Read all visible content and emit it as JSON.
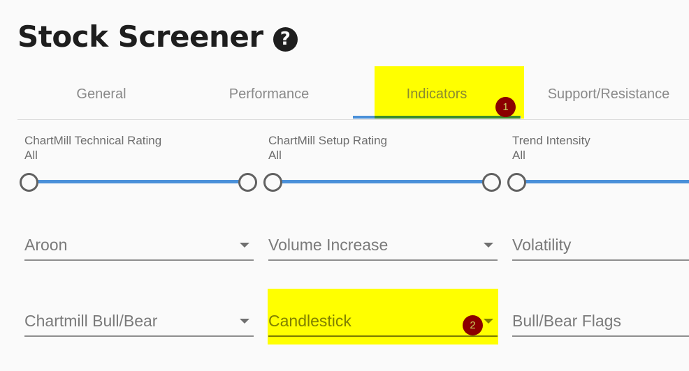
{
  "header": {
    "title": "Stock Screener",
    "help_icon": "?"
  },
  "tabs": [
    {
      "label": "General",
      "active": false
    },
    {
      "label": "Performance",
      "active": false
    },
    {
      "label": "Indicators",
      "active": true
    },
    {
      "label": "Support/Resistance",
      "active": false
    }
  ],
  "sliders": [
    {
      "label": "ChartMill Technical Rating",
      "value": "All",
      "range": [
        0,
        1
      ]
    },
    {
      "label": "ChartMill Setup Rating",
      "value": "All",
      "range": [
        0,
        1
      ]
    },
    {
      "label": "Trend Intensity",
      "value": "All",
      "range": [
        0,
        1
      ]
    }
  ],
  "selects": [
    {
      "label": "Aroon"
    },
    {
      "label": "Volume Increase"
    },
    {
      "label": "Volatility"
    },
    {
      "label": "Chartmill Bull/Bear"
    },
    {
      "label": "Candlestick"
    },
    {
      "label": "Bull/Bear Flags"
    }
  ],
  "annotations": [
    {
      "number": "1",
      "target": "Indicators tab",
      "highlight_color": "#ffff00",
      "badge_color": "#8b0000"
    },
    {
      "number": "2",
      "target": "Candlestick select",
      "highlight_color": "#ffff00",
      "badge_color": "#8b0000"
    }
  ]
}
